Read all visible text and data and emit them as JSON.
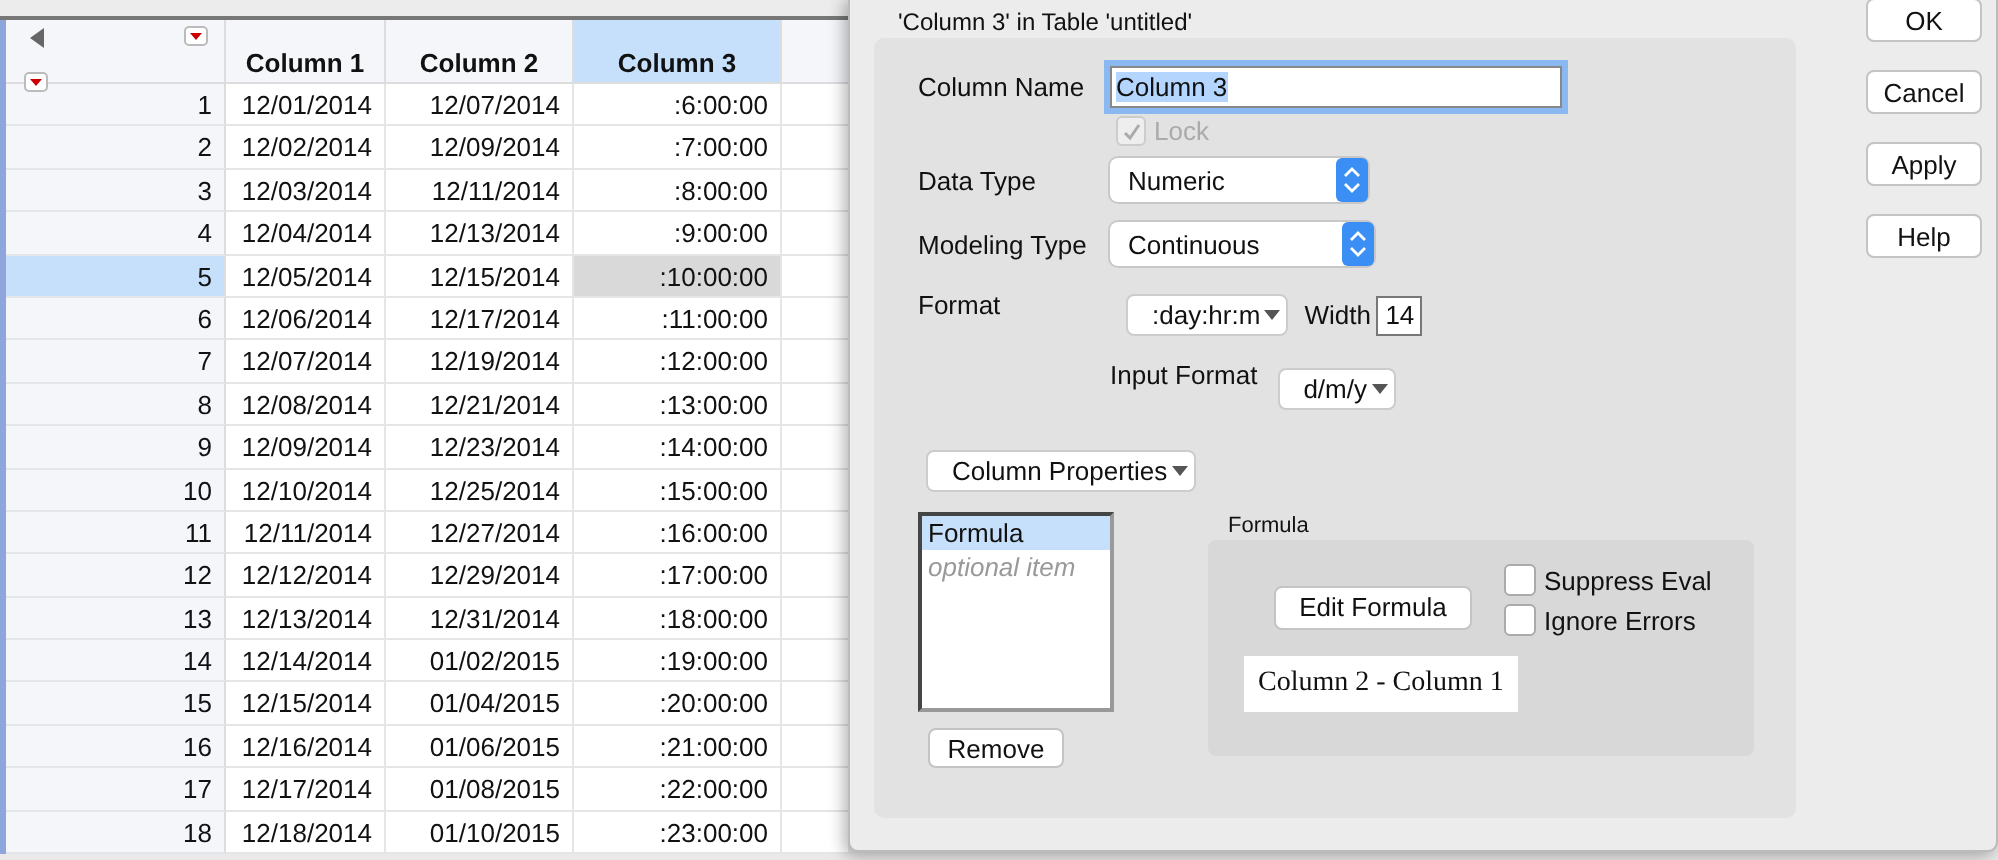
{
  "table": {
    "columns": [
      {
        "label": "Column 1",
        "selected": false
      },
      {
        "label": "Column 2",
        "selected": false
      },
      {
        "label": "Column 3",
        "selected": true
      }
    ],
    "rows": [
      {
        "number": "1",
        "selected": false,
        "cells": [
          "12/01/2014",
          "12/07/2014",
          ":6:00:00"
        ]
      },
      {
        "number": "2",
        "selected": false,
        "cells": [
          "12/02/2014",
          "12/09/2014",
          ":7:00:00"
        ]
      },
      {
        "number": "3",
        "selected": false,
        "cells": [
          "12/03/2014",
          "12/11/2014",
          ":8:00:00"
        ]
      },
      {
        "number": "4",
        "selected": false,
        "cells": [
          "12/04/2014",
          "12/13/2014",
          ":9:00:00"
        ]
      },
      {
        "number": "5",
        "selected": true,
        "cells": [
          "12/05/2014",
          "12/15/2014",
          ":10:00:00"
        ]
      },
      {
        "number": "6",
        "selected": false,
        "cells": [
          "12/06/2014",
          "12/17/2014",
          ":11:00:00"
        ]
      },
      {
        "number": "7",
        "selected": false,
        "cells": [
          "12/07/2014",
          "12/19/2014",
          ":12:00:00"
        ]
      },
      {
        "number": "8",
        "selected": false,
        "cells": [
          "12/08/2014",
          "12/21/2014",
          ":13:00:00"
        ]
      },
      {
        "number": "9",
        "selected": false,
        "cells": [
          "12/09/2014",
          "12/23/2014",
          ":14:00:00"
        ]
      },
      {
        "number": "10",
        "selected": false,
        "cells": [
          "12/10/2014",
          "12/25/2014",
          ":15:00:00"
        ]
      },
      {
        "number": "11",
        "selected": false,
        "cells": [
          "12/11/2014",
          "12/27/2014",
          ":16:00:00"
        ]
      },
      {
        "number": "12",
        "selected": false,
        "cells": [
          "12/12/2014",
          "12/29/2014",
          ":17:00:00"
        ]
      },
      {
        "number": "13",
        "selected": false,
        "cells": [
          "12/13/2014",
          "12/31/2014",
          ":18:00:00"
        ]
      },
      {
        "number": "14",
        "selected": false,
        "cells": [
          "12/14/2014",
          "01/02/2015",
          ":19:00:00"
        ]
      },
      {
        "number": "15",
        "selected": false,
        "cells": [
          "12/15/2014",
          "01/04/2015",
          ":20:00:00"
        ]
      },
      {
        "number": "16",
        "selected": false,
        "cells": [
          "12/16/2014",
          "01/06/2015",
          ":21:00:00"
        ]
      },
      {
        "number": "17",
        "selected": false,
        "cells": [
          "12/17/2014",
          "01/08/2015",
          ":22:00:00"
        ]
      },
      {
        "number": "18",
        "selected": false,
        "cells": [
          "12/18/2014",
          "01/10/2015",
          ":23:00:00"
        ]
      }
    ]
  },
  "dialog": {
    "title": "'Column 3' in Table 'untitled'",
    "column_name": {
      "label": "Column Name",
      "value": "Column 3"
    },
    "lock": {
      "label": "Lock",
      "checked": true,
      "disabled": true
    },
    "data_type": {
      "label": "Data Type",
      "value": "Numeric"
    },
    "modeling_type": {
      "label": "Modeling Type",
      "value": "Continuous"
    },
    "format": {
      "label": "Format",
      "value": ":day:hr:m",
      "width_label": "Width",
      "width_value": "14"
    },
    "input_format": {
      "label": "Input Format",
      "value": "d/m/y"
    },
    "column_properties": "Column Properties",
    "property_list": [
      {
        "label": "Formula",
        "kind": "item",
        "selected": true
      },
      {
        "label": "optional item",
        "kind": "placeholder",
        "selected": false
      }
    ],
    "remove_button": "Remove",
    "formula": {
      "title": "Formula",
      "edit_button": "Edit Formula",
      "options": [
        {
          "label": "Suppress Eval",
          "checked": false
        },
        {
          "label": "Ignore Errors",
          "checked": false
        }
      ],
      "expression": "Column 2 - Column 1"
    },
    "buttons": [
      "OK",
      "Cancel",
      "Apply",
      "Help"
    ]
  }
}
